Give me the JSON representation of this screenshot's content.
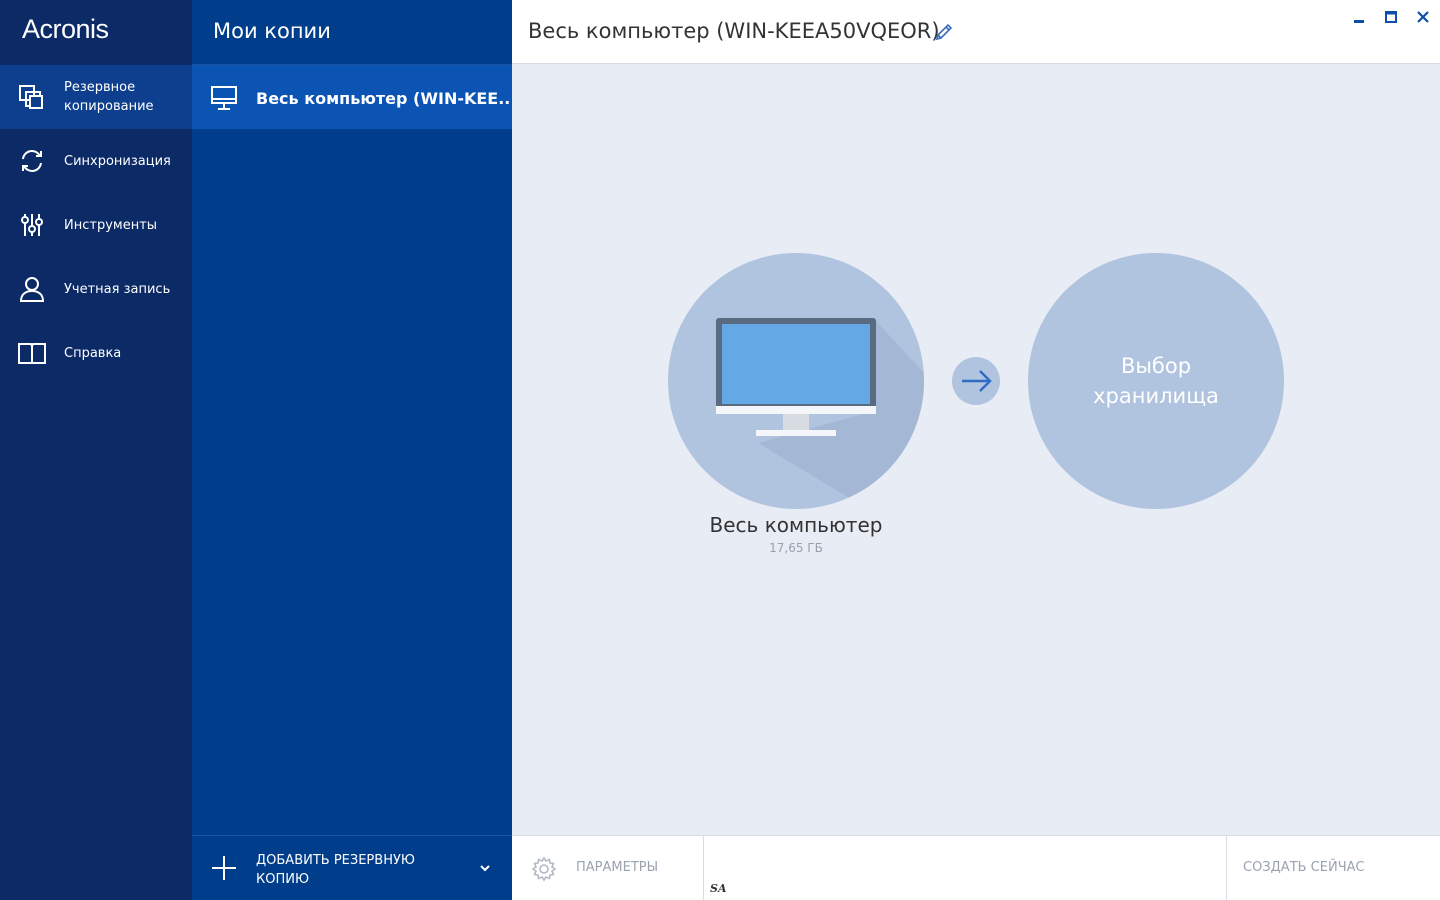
{
  "app": {
    "logo": "Acronis"
  },
  "nav": {
    "items": [
      {
        "label": "Резервное копирование",
        "icon": "backup-icon",
        "active": true
      },
      {
        "label": "Синхронизация",
        "icon": "sync-icon"
      },
      {
        "label": "Инструменты",
        "icon": "tools-icon"
      },
      {
        "label": "Учетная запись",
        "icon": "account-icon"
      },
      {
        "label": "Справка",
        "icon": "help-book-icon"
      }
    ]
  },
  "backups": {
    "title": "Мои копии",
    "items": [
      {
        "label": "Весь компьютер (WIN-KEE...",
        "icon": "monitor-icon"
      }
    ],
    "add_label": "ДОБАВИТЬ РЕЗЕРВНУЮ КОПИЮ"
  },
  "main": {
    "title": "Весь компьютер (WIN-KEEA50VQEOR)",
    "source": {
      "label": "Весь компьютер",
      "size": "17,65 ГБ"
    },
    "destination": {
      "label": "Выбор хранилища"
    }
  },
  "footer": {
    "params_label": "ПАРАМЕТРЫ",
    "create_label": "СОЗДАТЬ СЕЙЧАС",
    "watermark": "SA"
  },
  "colors": {
    "nav_bg": "#0b2a66",
    "nav_active": "#0e3f8f",
    "mid_bg": "#003e8c",
    "selected_item": "#0c54b4",
    "circle": "#b0c3df",
    "main_bg": "#e8ecf4"
  }
}
